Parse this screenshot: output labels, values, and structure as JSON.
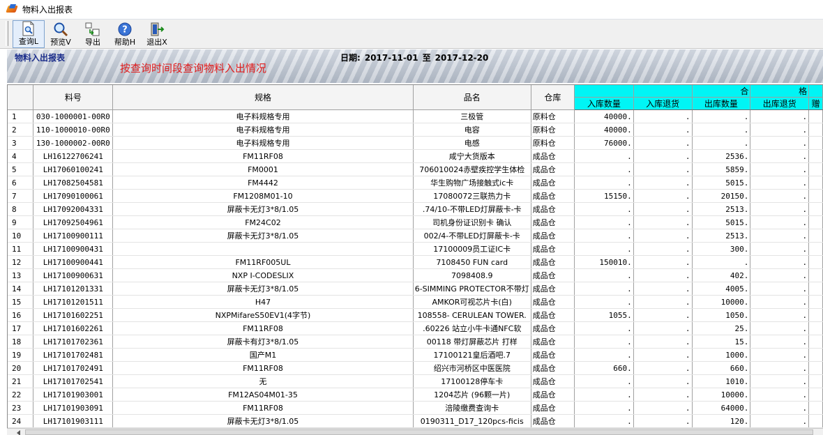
{
  "window": {
    "title": "物料入出报表"
  },
  "toolbar": {
    "buttons": [
      {
        "label": "查询L",
        "icon": "query-icon"
      },
      {
        "label": "预览V",
        "icon": "preview-icon"
      },
      {
        "label": "导出",
        "icon": "export-icon"
      },
      {
        "label": "帮助H",
        "icon": "help-icon"
      },
      {
        "label": "退出X",
        "icon": "exit-icon"
      }
    ]
  },
  "banner": {
    "report_title": "物料入出报表",
    "note": "按查询时间段查询物料入出情况",
    "date_label": "日期:",
    "date_from": "2017-11-01",
    "date_sep": "至",
    "date_to": "2017-12-20"
  },
  "table": {
    "group_header_1": "合",
    "group_header_2": "格",
    "columns": [
      "料号",
      "规格",
      "品名",
      "仓库",
      "入库数量",
      "入库退货",
      "出库数量",
      "出库退货",
      "赠"
    ],
    "rows": [
      [
        "1",
        "030-1000001-00R0",
        "电子料规格专用",
        "三极管",
        "原料仓",
        "40000.",
        ".",
        ".",
        ".",
        ""
      ],
      [
        "2",
        "110-1000010-00R0",
        "电子料规格专用",
        "电容",
        "原料仓",
        "40000.",
        ".",
        ".",
        ".",
        ""
      ],
      [
        "3",
        "130-1000002-00R0",
        "电子料规格专用",
        "电感",
        "原料仓",
        "76000.",
        ".",
        ".",
        ".",
        ""
      ],
      [
        "4",
        "LH16122706241",
        "FM11RF08",
        "咸宁大货版本",
        "成品仓",
        ".",
        ".",
        "2536.",
        ".",
        ""
      ],
      [
        "5",
        "LH17060100241",
        "FM0001",
        "706010024赤壁疾控学生体检",
        "成品仓",
        ".",
        ".",
        "5859.",
        ".",
        ""
      ],
      [
        "6",
        "LH17082504581",
        "FM4442",
        "华生购物广场接触式ic卡",
        "成品仓",
        ".",
        ".",
        "5015.",
        ".",
        ""
      ],
      [
        "7",
        "LH17090100061",
        "FM1208M01-10",
        "17080072三联热力卡",
        "成品仓",
        "15150.",
        ".",
        "20150.",
        ".",
        ""
      ],
      [
        "8",
        "LH17092004331",
        "屏蔽卡无灯3*8/1.05",
        ".74/10-不带LED灯屏蔽卡-卡",
        "成品仓",
        ".",
        ".",
        "2513.",
        ".",
        ""
      ],
      [
        "9",
        "LH17092504961",
        "FM24C02",
        "司机身份证识别卡 确认",
        "成品仓",
        ".",
        ".",
        "5015.",
        ".",
        ""
      ],
      [
        "10",
        "LH17100900111",
        "屏蔽卡无灯3*8/1.05",
        "002/4-不带LED灯屏蔽卡-卡",
        "成品仓",
        ".",
        ".",
        "2513.",
        ".",
        ""
      ],
      [
        "11",
        "LH17100900431",
        "",
        "17100009员工证IC卡",
        "成品仓",
        ".",
        ".",
        "300.",
        ".",
        ""
      ],
      [
        "12",
        "LH17100900441",
        "FM11RF005UL",
        "7108450 FUN card",
        "成品仓",
        "150010.",
        ".",
        ".",
        ".",
        ""
      ],
      [
        "13",
        "LH17100900631",
        "NXP I-CODESLIX",
        "7098408.9",
        "成品仓",
        ".",
        ".",
        "402.",
        ".",
        ""
      ],
      [
        "14",
        "LH17101201331",
        "屏蔽卡无灯3*8/1.05",
        "6-SIMMING PROTECTOR不带灯",
        "成品仓",
        ".",
        ".",
        "4005.",
        ".",
        ""
      ],
      [
        "15",
        "LH17101201511",
        "H47",
        "AMKOR可视芯片卡(白)",
        "成品仓",
        ".",
        ".",
        "10000.",
        ".",
        ""
      ],
      [
        "16",
        "LH17101602251",
        "NXPMifareS50EV1(4字节)",
        "108558- CERULEAN TOWER.",
        "成品仓",
        "1055.",
        ".",
        "1050.",
        ".",
        ""
      ],
      [
        "17",
        "LH17101602261",
        "FM11RF08",
        ".60226 站立小牛卡通NFC软",
        "成品仓",
        ".",
        ".",
        "25.",
        ".",
        ""
      ],
      [
        "18",
        "LH17101702361",
        "屏蔽卡有灯3*8/1.05",
        "00118 带灯屏蔽芯片 打样",
        "成品仓",
        ".",
        ".",
        "15.",
        ".",
        ""
      ],
      [
        "19",
        "LH17101702481",
        "国产M1",
        "17100121皇后酒吧.7",
        "成品仓",
        ".",
        ".",
        "1000.",
        ".",
        ""
      ],
      [
        "20",
        "LH17101702491",
        "FM11RF08",
        "绍兴市河桥区中医医院",
        "成品仓",
        "660.",
        ".",
        "660.",
        ".",
        ""
      ],
      [
        "21",
        "LH17101702541",
        "无",
        "17100128停车卡",
        "成品仓",
        ".",
        ".",
        "1010.",
        ".",
        ""
      ],
      [
        "22",
        "LH17101903001",
        "FM12AS04M01-35",
        "1204芯片 (96颗一片)",
        "成品仓",
        ".",
        ".",
        "10000.",
        ".",
        ""
      ],
      [
        "23",
        "LH17101903091",
        "FM11RF08",
        "涪陵缴费查询卡",
        "成品仓",
        ".",
        ".",
        "64000.",
        ".",
        ""
      ],
      [
        "24",
        "LH17101903111",
        "屏蔽卡无灯3*8/1.05",
        "0190311_D17_120pcs-ficis",
        "成品仓",
        ".",
        ".",
        "120.",
        ".",
        ""
      ]
    ]
  }
}
